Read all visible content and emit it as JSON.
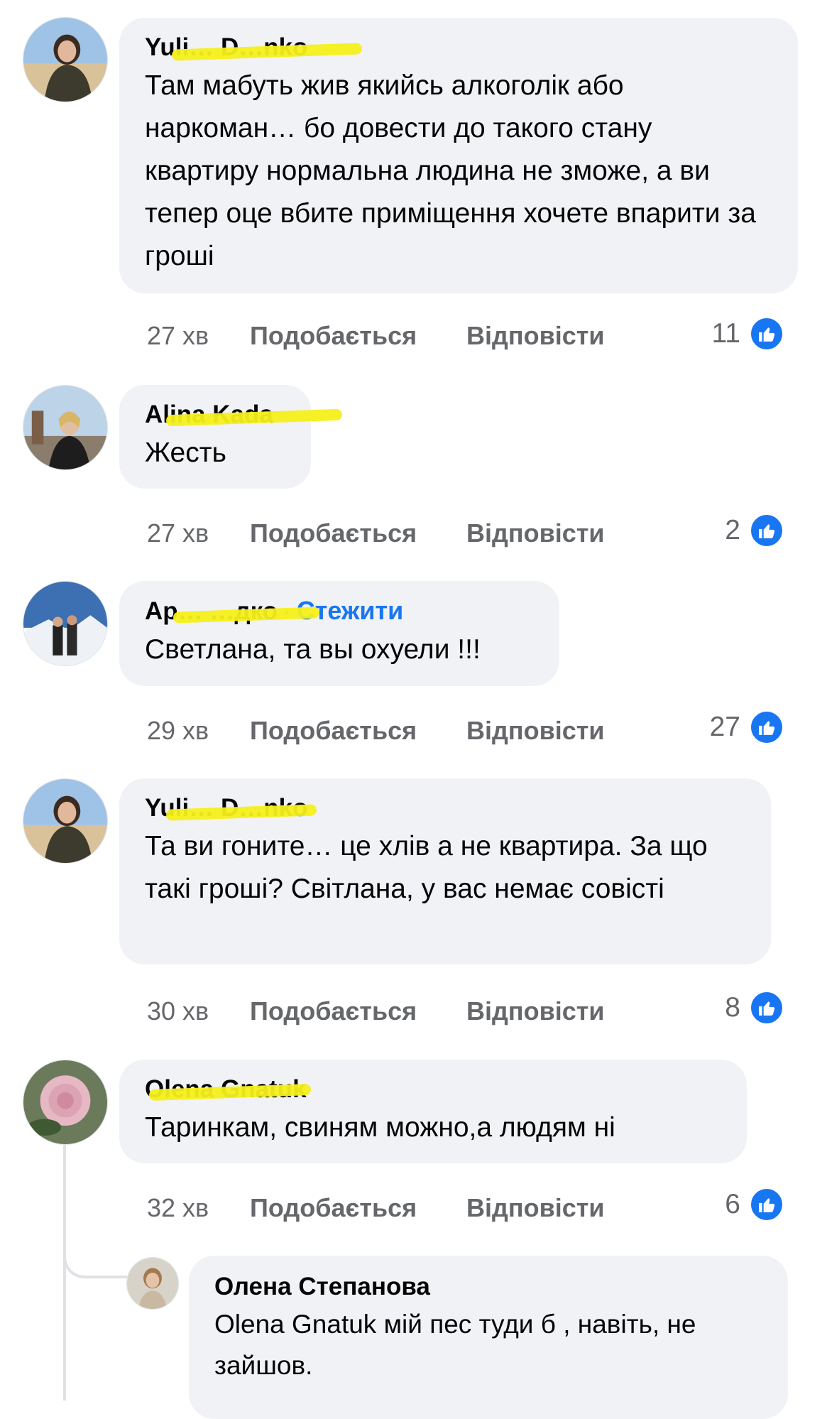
{
  "comments": [
    {
      "author": "Yuli… D…nko",
      "text": "Там мабуть жив якийсь алкоголік або наркоман… бо довести до такого стану квартиру нормальна людина не зможе, а ви тепер оце вбите приміщення хочете впарити за гроші",
      "time": "27 хв",
      "like_label": "Подобається",
      "reply_label": "Відповісти",
      "reactions": "11",
      "reaction_icon": "like-icon"
    },
    {
      "author": "Alina Kada",
      "text": "Жесть",
      "time": "27 хв",
      "like_label": "Подобається",
      "reply_label": "Відповісти",
      "reactions": "2",
      "reaction_icon": "like-icon"
    },
    {
      "author": "Ар… …дко",
      "follow": "Стежити",
      "text": "Светлана, та вы охуели !!!",
      "time": "29 хв",
      "like_label": "Подобається",
      "reply_label": "Відповісти",
      "reactions": "27",
      "reaction_icon": "like-icon"
    },
    {
      "author": "Yuli… D…nko",
      "text": "Та ви гоните… це хлів а не квартира. За що такі гроші? Світлана, у вас немає совісті",
      "time": "30 хв",
      "like_label": "Подобається",
      "reply_label": "Відповісти",
      "reactions": "8",
      "reaction_icon": "like-icon"
    },
    {
      "author": "Olena Gnatuk",
      "text": "Таринкам, свиням можно,а людям ні",
      "time": "32 хв",
      "like_label": "Подобається",
      "reply_label": "Відповісти",
      "reactions": "6",
      "reaction_icon": "like-icon"
    }
  ],
  "reply": {
    "author": "Олена Степанова",
    "text": "Olena Gnatuk мій пес туди б , навіть, не зайшов."
  },
  "colors": {
    "bubble": "#f0f2f5",
    "accent": "#1876f2",
    "muted": "#65676b",
    "redaction": "#f5ef1a"
  }
}
